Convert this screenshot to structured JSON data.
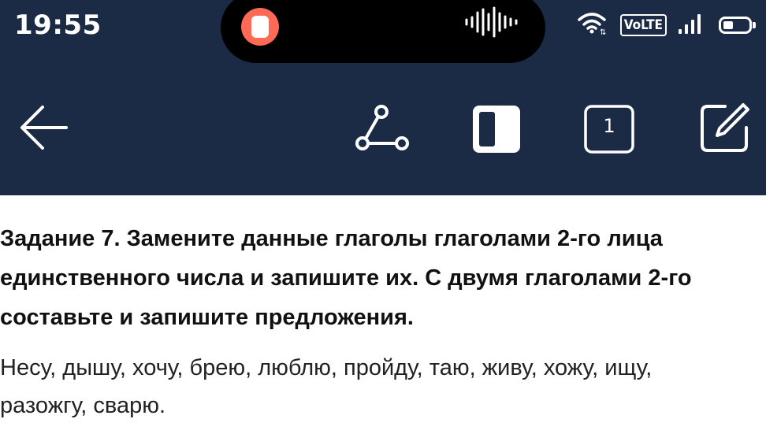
{
  "status_bar": {
    "time": "19:55",
    "network_badge": "VoLTE",
    "icons": [
      "screen-record-icon",
      "audio-waveform-icon",
      "wifi-icon",
      "signal-bars-icon",
      "battery-icon"
    ]
  },
  "toolbar": {
    "icons": [
      "back-arrow-icon",
      "share-nodes-icon",
      "reading-mode-icon",
      "page-counter-icon",
      "edit-icon"
    ],
    "page_count": "1"
  },
  "content": {
    "task_lines": [
      "Задание 7. Замените данные глаголы глаголами 2-го лица",
      "единственного числа и запишите их. С двумя глаголами 2-го",
      "составьте и запишите предложения."
    ],
    "word_lines": [
      "Несу, дышу, хочу, брею, люблю, пройду, таю, живу, хожу, ищу,",
      "разожгу, сварю."
    ]
  },
  "colors": {
    "header_bg": "#1c2b45",
    "record_accent": "#ff6a54",
    "text_dark": "#111111"
  }
}
